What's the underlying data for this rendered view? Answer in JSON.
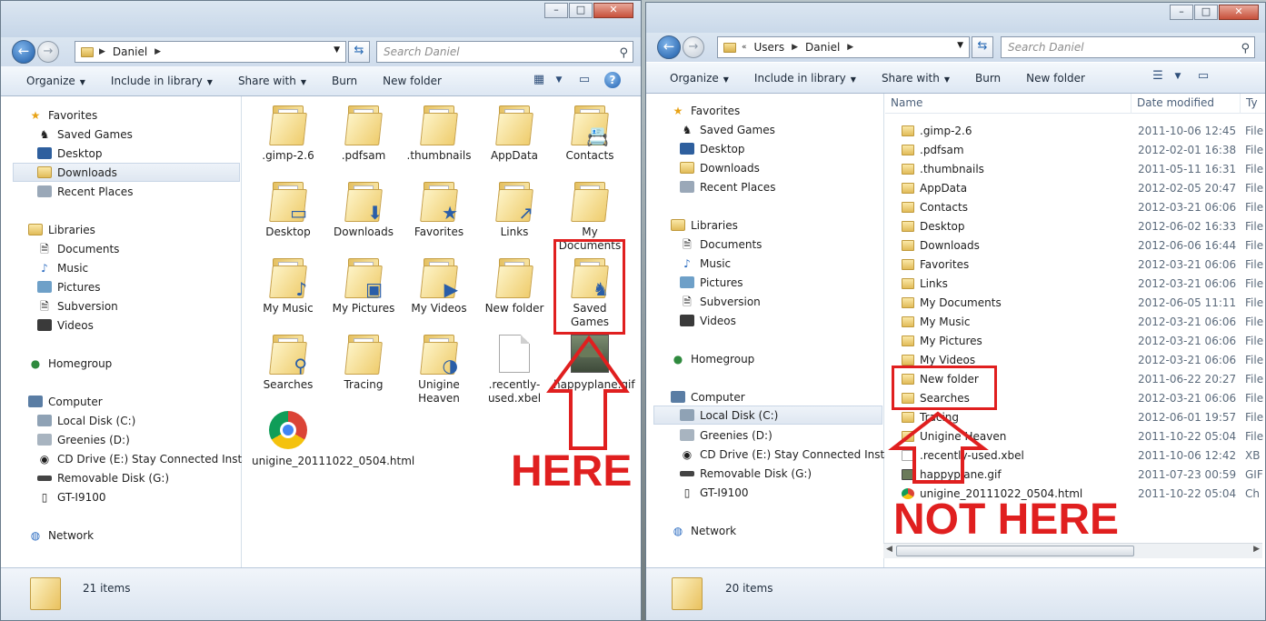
{
  "window_left": {
    "address": [
      "Daniel"
    ],
    "search_placeholder": "Search Daniel",
    "toolbar": [
      {
        "label": "Organize",
        "dropdown": true
      },
      {
        "label": "Include in library",
        "dropdown": true
      },
      {
        "label": "Share with",
        "dropdown": true
      },
      {
        "label": "Burn",
        "dropdown": false
      },
      {
        "label": "New folder",
        "dropdown": false
      }
    ],
    "nav": {
      "favorites_header": "Favorites",
      "favorites": [
        "Saved Games",
        "Desktop",
        "Downloads",
        "Recent Places"
      ],
      "libraries_header": "Libraries",
      "libraries": [
        "Documents",
        "Music",
        "Pictures",
        "Subversion",
        "Videos"
      ],
      "homegroup": "Homegroup",
      "computer_header": "Computer",
      "computer": [
        "Local Disk (C:)",
        "Greenies (D:)",
        "CD Drive (E:) Stay Connected Installer",
        "Removable Disk (G:)",
        "GT-I9100"
      ],
      "network": "Network"
    },
    "tiles": [
      ".gimp-2.6",
      ".pdfsam",
      ".thumbnails",
      "AppData",
      "Contacts",
      "Desktop",
      "Downloads",
      "Favorites",
      "Links",
      "My Documents",
      "My Music",
      "My Pictures",
      "My Videos",
      "New folder",
      "Saved Games",
      "Searches",
      "Tracing",
      "Unigine Heaven",
      ".recently-used.xbel",
      "happyplane.gif",
      "unigine_20111022_0504.html"
    ],
    "status": "21 items",
    "annotation": "HERE"
  },
  "window_right": {
    "address": [
      "Users",
      "Daniel"
    ],
    "address_overflow": "«",
    "search_placeholder": "Search Daniel",
    "toolbar": [
      {
        "label": "Organize",
        "dropdown": true
      },
      {
        "label": "Include in library",
        "dropdown": true
      },
      {
        "label": "Share with",
        "dropdown": true
      },
      {
        "label": "Burn",
        "dropdown": false
      },
      {
        "label": "New folder",
        "dropdown": false
      }
    ],
    "nav": {
      "favorites_header": "Favorites",
      "favorites": [
        "Saved Games",
        "Desktop",
        "Downloads",
        "Recent Places"
      ],
      "libraries_header": "Libraries",
      "libraries": [
        "Documents",
        "Music",
        "Pictures",
        "Subversion",
        "Videos"
      ],
      "homegroup": "Homegroup",
      "computer_header": "Computer",
      "computer": [
        "Local Disk (C:)",
        "Greenies (D:)",
        "CD Drive (E:) Stay Connected Installer",
        "Removable Disk (G:)",
        "GT-I9100"
      ],
      "network": "Network"
    },
    "columns": [
      "Name",
      "Date modified",
      "Ty"
    ],
    "rows": [
      {
        "name": ".gimp-2.6",
        "date": "2011-10-06 12:45",
        "type": "File"
      },
      {
        "name": ".pdfsam",
        "date": "2012-02-01 16:38",
        "type": "File"
      },
      {
        "name": ".thumbnails",
        "date": "2011-05-11 16:31",
        "type": "File"
      },
      {
        "name": "AppData",
        "date": "2012-02-05 20:47",
        "type": "File"
      },
      {
        "name": "Contacts",
        "date": "2012-03-21 06:06",
        "type": "File"
      },
      {
        "name": "Desktop",
        "date": "2012-06-02 16:33",
        "type": "File"
      },
      {
        "name": "Downloads",
        "date": "2012-06-06 16:44",
        "type": "File"
      },
      {
        "name": "Favorites",
        "date": "2012-03-21 06:06",
        "type": "File"
      },
      {
        "name": "Links",
        "date": "2012-03-21 06:06",
        "type": "File"
      },
      {
        "name": "My Documents",
        "date": "2012-06-05 11:11",
        "type": "File"
      },
      {
        "name": "My Music",
        "date": "2012-03-21 06:06",
        "type": "File"
      },
      {
        "name": "My Pictures",
        "date": "2012-03-21 06:06",
        "type": "File"
      },
      {
        "name": "My Videos",
        "date": "2012-03-21 06:06",
        "type": "File"
      },
      {
        "name": "New folder",
        "date": "2011-06-22 20:27",
        "type": "File"
      },
      {
        "name": "Searches",
        "date": "2012-03-21 06:06",
        "type": "File"
      },
      {
        "name": "Tracing",
        "date": "2012-06-01 19:57",
        "type": "File"
      },
      {
        "name": "Unigine Heaven",
        "date": "2011-10-22 05:04",
        "type": "File"
      },
      {
        "name": ".recently-used.xbel",
        "date": "2011-10-06 12:42",
        "type": "XB"
      },
      {
        "name": "happyplane.gif",
        "date": "2011-07-23 00:59",
        "type": "GIF"
      },
      {
        "name": "unigine_20111022_0504.html",
        "date": "2011-10-22 05:04",
        "type": "Ch"
      }
    ],
    "status": "20 items",
    "annotation": "NOT HERE"
  }
}
